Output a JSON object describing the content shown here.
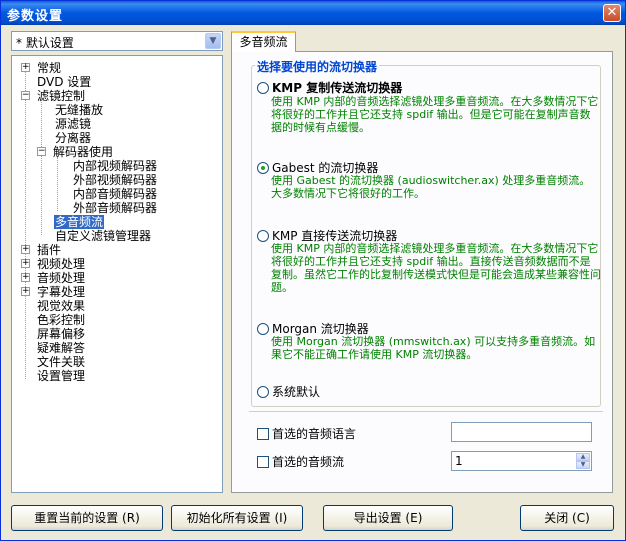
{
  "window": {
    "title": "参数设置",
    "close_glyph": "✕"
  },
  "profile": {
    "selected": "* 默认设置"
  },
  "tree": [
    {
      "label": "常规",
      "exp": "+"
    },
    {
      "label": "DVD 设置",
      "exp": ""
    },
    {
      "label": "滤镜控制",
      "exp": "−"
    },
    {
      "label": "无缝播放",
      "exp": ""
    },
    {
      "label": "源滤镜",
      "exp": ""
    },
    {
      "label": "分离器",
      "exp": ""
    },
    {
      "label": "解码器使用",
      "exp": "−"
    },
    {
      "label": "内部视频解码器",
      "exp": ""
    },
    {
      "label": "外部视频解码器",
      "exp": ""
    },
    {
      "label": "内部音频解码器",
      "exp": ""
    },
    {
      "label": "外部音频解码器",
      "exp": ""
    },
    {
      "label": "多音频流",
      "exp": ""
    },
    {
      "label": "自定义滤镜管理器",
      "exp": ""
    },
    {
      "label": "插件",
      "exp": "+"
    },
    {
      "label": "视频处理",
      "exp": "+"
    },
    {
      "label": "音频处理",
      "exp": "+"
    },
    {
      "label": "字幕处理",
      "exp": "+"
    },
    {
      "label": "视觉效果",
      "exp": ""
    },
    {
      "label": "色彩控制",
      "exp": ""
    },
    {
      "label": "屏幕偏移",
      "exp": ""
    },
    {
      "label": "疑难解答",
      "exp": ""
    },
    {
      "label": "文件关联",
      "exp": ""
    },
    {
      "label": "设置管理",
      "exp": ""
    }
  ],
  "tab": {
    "label": "多音频流"
  },
  "group": {
    "title": "选择要使用的流切换器"
  },
  "options": [
    {
      "label": "KMP 复制传送流切换器",
      "desc": "使用 KMP 内部的音频选择滤镜处理多重音频流。在大多数情况下它将很好的工作并且它还支持 spdif 输出。但是它可能在复制声音数据的时候有点缓慢。"
    },
    {
      "label": "Gabest 的流切换器",
      "desc": "使用 Gabest 的流切换器 (audioswitcher.ax) 处理多重音频流。大多数情况下它将很好的工作。"
    },
    {
      "label": "KMP 直接传送流切换器",
      "desc": "使用 KMP 内部的音频选择滤镜处理多重音频流。在大多数情况下它将很好的工作并且它还支持 spdif 输出。直接传送音频数据而不是复制。虽然它工作的比复制传送模式快但是可能会造成某些兼容性问题。"
    },
    {
      "label": "Morgan 流切换器",
      "desc": "使用 Morgan 流切换器 (mmswitch.ax) 可以支持多重音频流。如果它不能正确工作请使用 KMP 流切换器。"
    },
    {
      "label": "系统默认",
      "desc": ""
    }
  ],
  "pref_lang": {
    "label": "首选的音频语言",
    "value": ""
  },
  "pref_stream": {
    "label": "首选的音频流",
    "value": "1"
  },
  "buttons": {
    "reset": "重置当前的设置 (R)",
    "init": "初始化所有设置 (I)",
    "export": "导出设置 (E)",
    "close": "关闭 (C)"
  }
}
